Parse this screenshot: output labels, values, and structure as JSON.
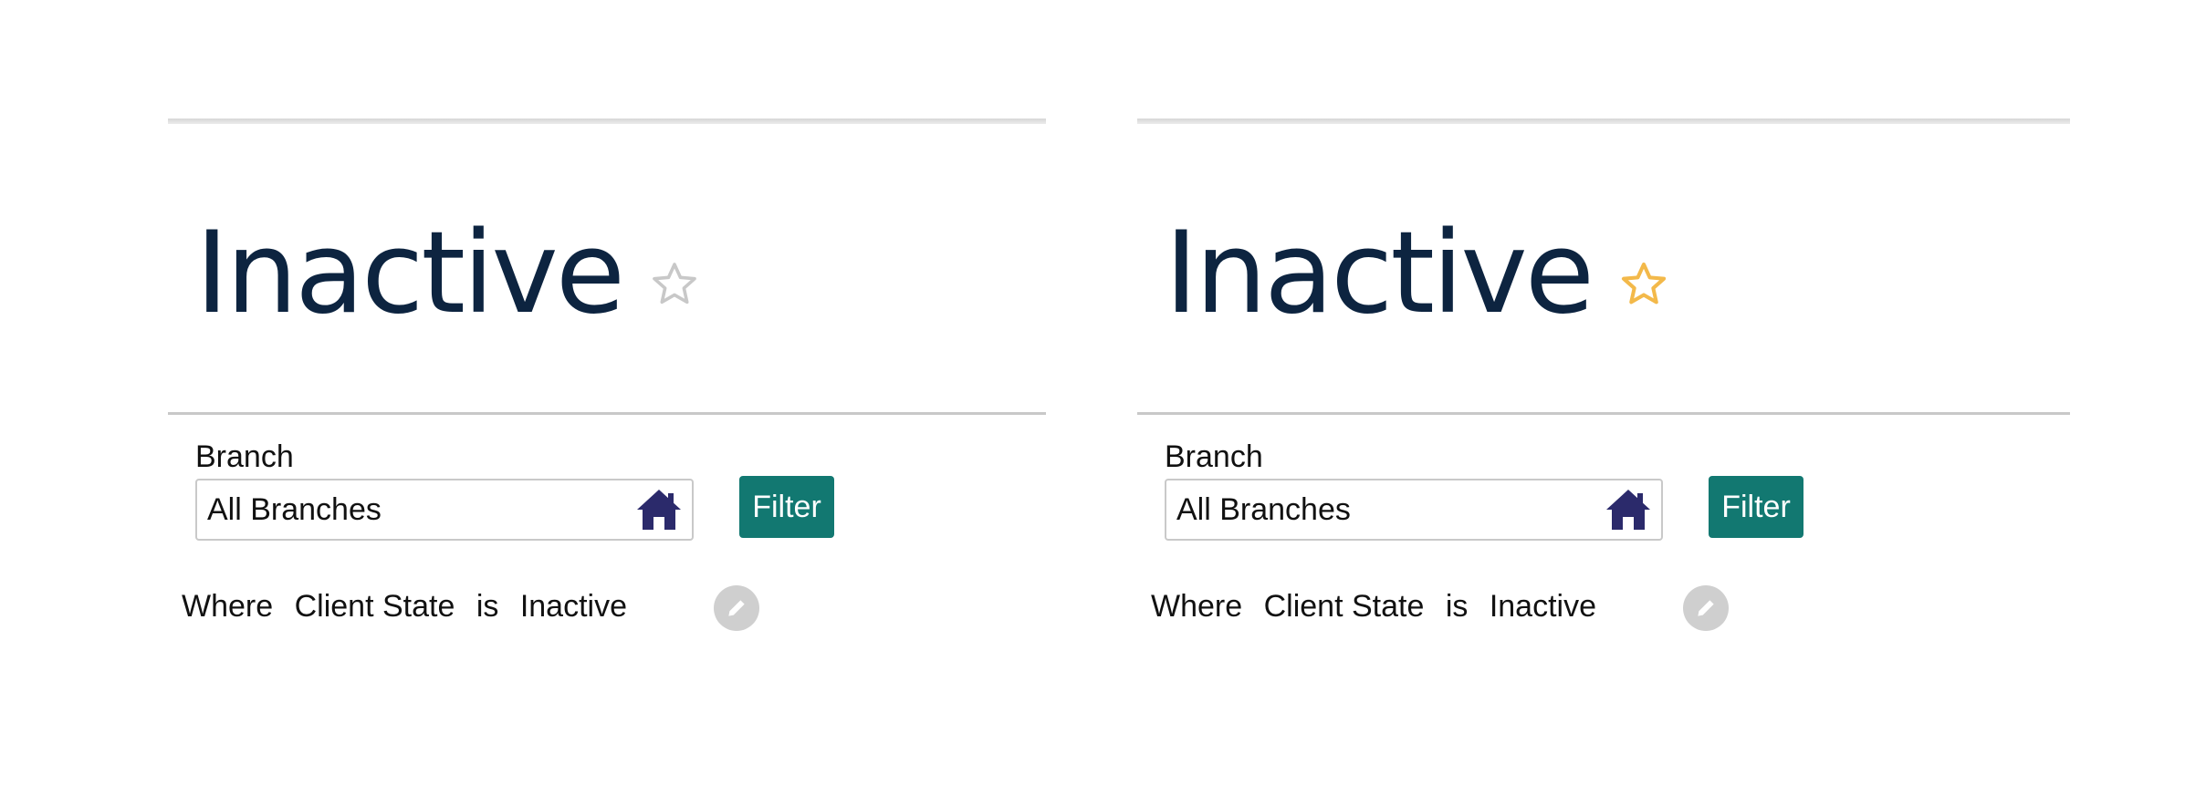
{
  "panels": [
    {
      "title": "Inactive",
      "favorite": false,
      "branch_label": "Branch",
      "branch_value": "All Branches",
      "filter_label": "Filter",
      "criteria": {
        "w1": "Where",
        "w2": "Client State",
        "w3": "is",
        "w4": "Inactive"
      },
      "icons": {
        "favorite": "star-outline-icon",
        "branch": "home-icon",
        "edit": "pencil-icon"
      }
    },
    {
      "title": "Inactive",
      "favorite": true,
      "branch_label": "Branch",
      "branch_value": "All Branches",
      "filter_label": "Filter",
      "criteria": {
        "w1": "Where",
        "w2": "Client State",
        "w3": "is",
        "w4": "Inactive"
      },
      "icons": {
        "favorite": "star-outline-icon",
        "branch": "home-icon",
        "edit": "pencil-icon"
      }
    }
  ],
  "colors": {
    "title": "#0d2440",
    "star_inactive": "#c8c8c8",
    "star_active": "#f3b94a",
    "filter_button": "#127871",
    "home_icon": "#2b2a6b",
    "edit_button": "#cfcfcf"
  }
}
